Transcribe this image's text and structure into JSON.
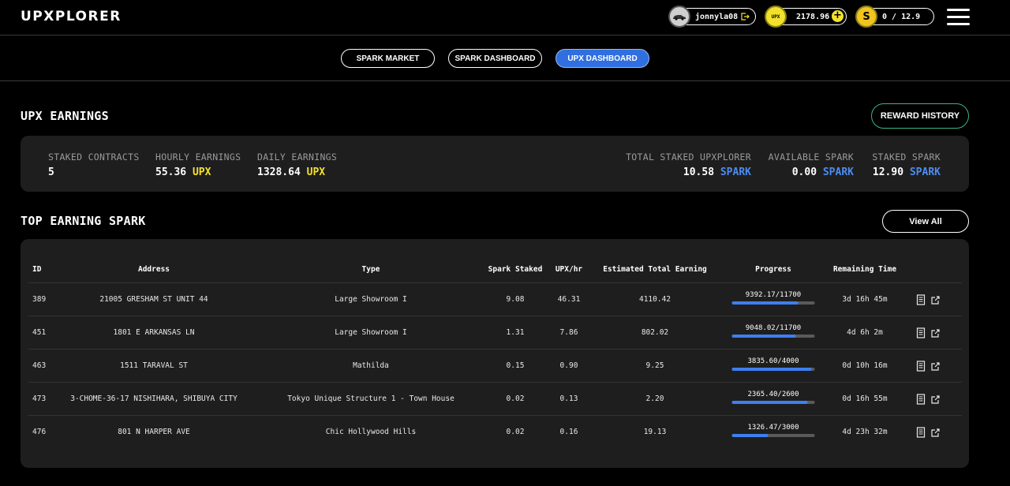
{
  "header": {
    "logo": "UPXPLORER",
    "user": {
      "name": "jonnyla08"
    },
    "upx": {
      "badge": "UPX",
      "amount": "2178.96"
    },
    "spark": {
      "badge": "S",
      "amount": "0 / 12.9"
    }
  },
  "nav": {
    "tabs": [
      {
        "label": "SPARK MARKET",
        "active": false
      },
      {
        "label": "SPARK DASHBOARD",
        "active": false
      },
      {
        "label": "UPX DASHBOARD",
        "active": true
      }
    ]
  },
  "earnings": {
    "title": "UPX EARNINGS",
    "reward_history_label": "REWARD HISTORY",
    "stats_left": [
      {
        "label": "STAKED CONTRACTS",
        "value": "5",
        "unit": ""
      },
      {
        "label": "HOURLY EARNINGS",
        "value": "55.36",
        "unit": "UPX"
      },
      {
        "label": "DAILY EARNINGS",
        "value": "1328.64",
        "unit": "UPX"
      }
    ],
    "stats_right": [
      {
        "label": "TOTAL STAKED UPXPLORER",
        "value": "10.58",
        "unit": "SPARK"
      },
      {
        "label": "AVAILABLE SPARK",
        "value": "0.00",
        "unit": "SPARK"
      },
      {
        "label": "STAKED SPARK",
        "value": "12.90",
        "unit": "SPARK"
      }
    ]
  },
  "top_earning": {
    "title": "TOP EARNING SPARK",
    "view_all_label": "View All",
    "columns": [
      "ID",
      "Address",
      "Type",
      "Spark Staked",
      "UPX/hr",
      "Estimated Total Earning",
      "Progress",
      "Remaining Time"
    ],
    "rows": [
      {
        "id": "389",
        "address": "21005 GRESHAM ST UNIT 44",
        "type": "Large Showroom I",
        "spark_staked": "9.08",
        "upx_hr": "46.31",
        "est_total": "4110.42",
        "progress_text": "9392.17/11700",
        "progress": 0.8027,
        "remaining": "3d 16h 45m"
      },
      {
        "id": "451",
        "address": "1801 E ARKANSAS LN",
        "type": "Large Showroom I",
        "spark_staked": "1.31",
        "upx_hr": "7.86",
        "est_total": "802.02",
        "progress_text": "9048.02/11700",
        "progress": 0.7733,
        "remaining": "4d 6h 2m"
      },
      {
        "id": "463",
        "address": "1511 TARAVAL ST",
        "type": "Mathilda",
        "spark_staked": "0.15",
        "upx_hr": "0.90",
        "est_total": "9.25",
        "progress_text": "3835.60/4000",
        "progress": 0.9589,
        "remaining": "0d 10h 16m"
      },
      {
        "id": "473",
        "address": "3-CHOME-36-17 NISHIHARA, SHIBUYA CITY",
        "type": "Tokyo Unique Structure 1 - Town House",
        "spark_staked": "0.02",
        "upx_hr": "0.13",
        "est_total": "2.20",
        "progress_text": "2365.40/2600",
        "progress": 0.9098,
        "remaining": "0d 16h 55m"
      },
      {
        "id": "476",
        "address": "801 N HARPER AVE",
        "type": "Chic Hollywood Hills",
        "spark_staked": "0.02",
        "upx_hr": "0.16",
        "est_total": "19.13",
        "progress_text": "1326.47/3000",
        "progress": 0.4422,
        "remaining": "4d 23h 32m"
      }
    ]
  }
}
